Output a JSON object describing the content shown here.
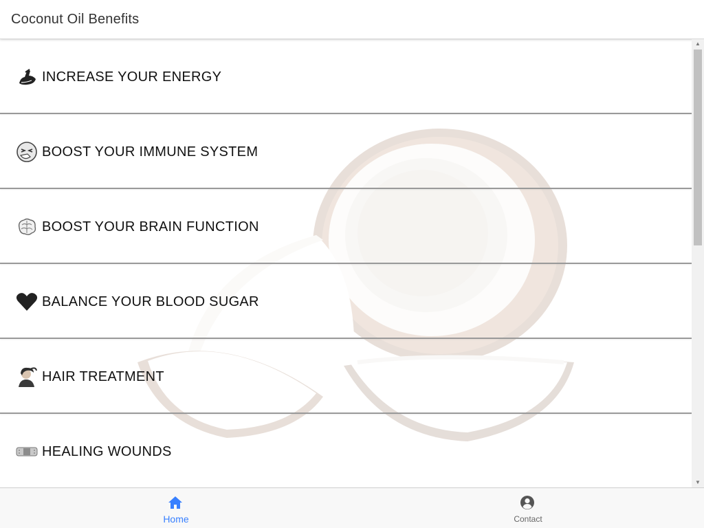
{
  "header": {
    "title": "Coconut Oil Benefits"
  },
  "list": {
    "items": [
      {
        "label": "INCREASE YOUR ENERGY",
        "icon": "flexing-arm-icon"
      },
      {
        "label": "BOOST YOUR IMMUNE SYSTEM",
        "icon": "sneezing-face-icon"
      },
      {
        "label": "BOOST YOUR BRAIN FUNCTION",
        "icon": "brain-icon"
      },
      {
        "label": "BALANCE YOUR BLOOD SUGAR",
        "icon": "heart-icon"
      },
      {
        "label": "HAIR TREATMENT",
        "icon": "woman-hair-icon"
      },
      {
        "label": "HEALING WOUNDS",
        "icon": "bandage-icon"
      }
    ]
  },
  "tabs": [
    {
      "label": "Home",
      "icon": "home-icon",
      "selected": true
    },
    {
      "label": "Contact",
      "icon": "person-circle-icon",
      "selected": false
    }
  ],
  "colors": {
    "accent": "#3880ff",
    "tab_inactive": "#666666",
    "divider": "#9a9a9a"
  }
}
